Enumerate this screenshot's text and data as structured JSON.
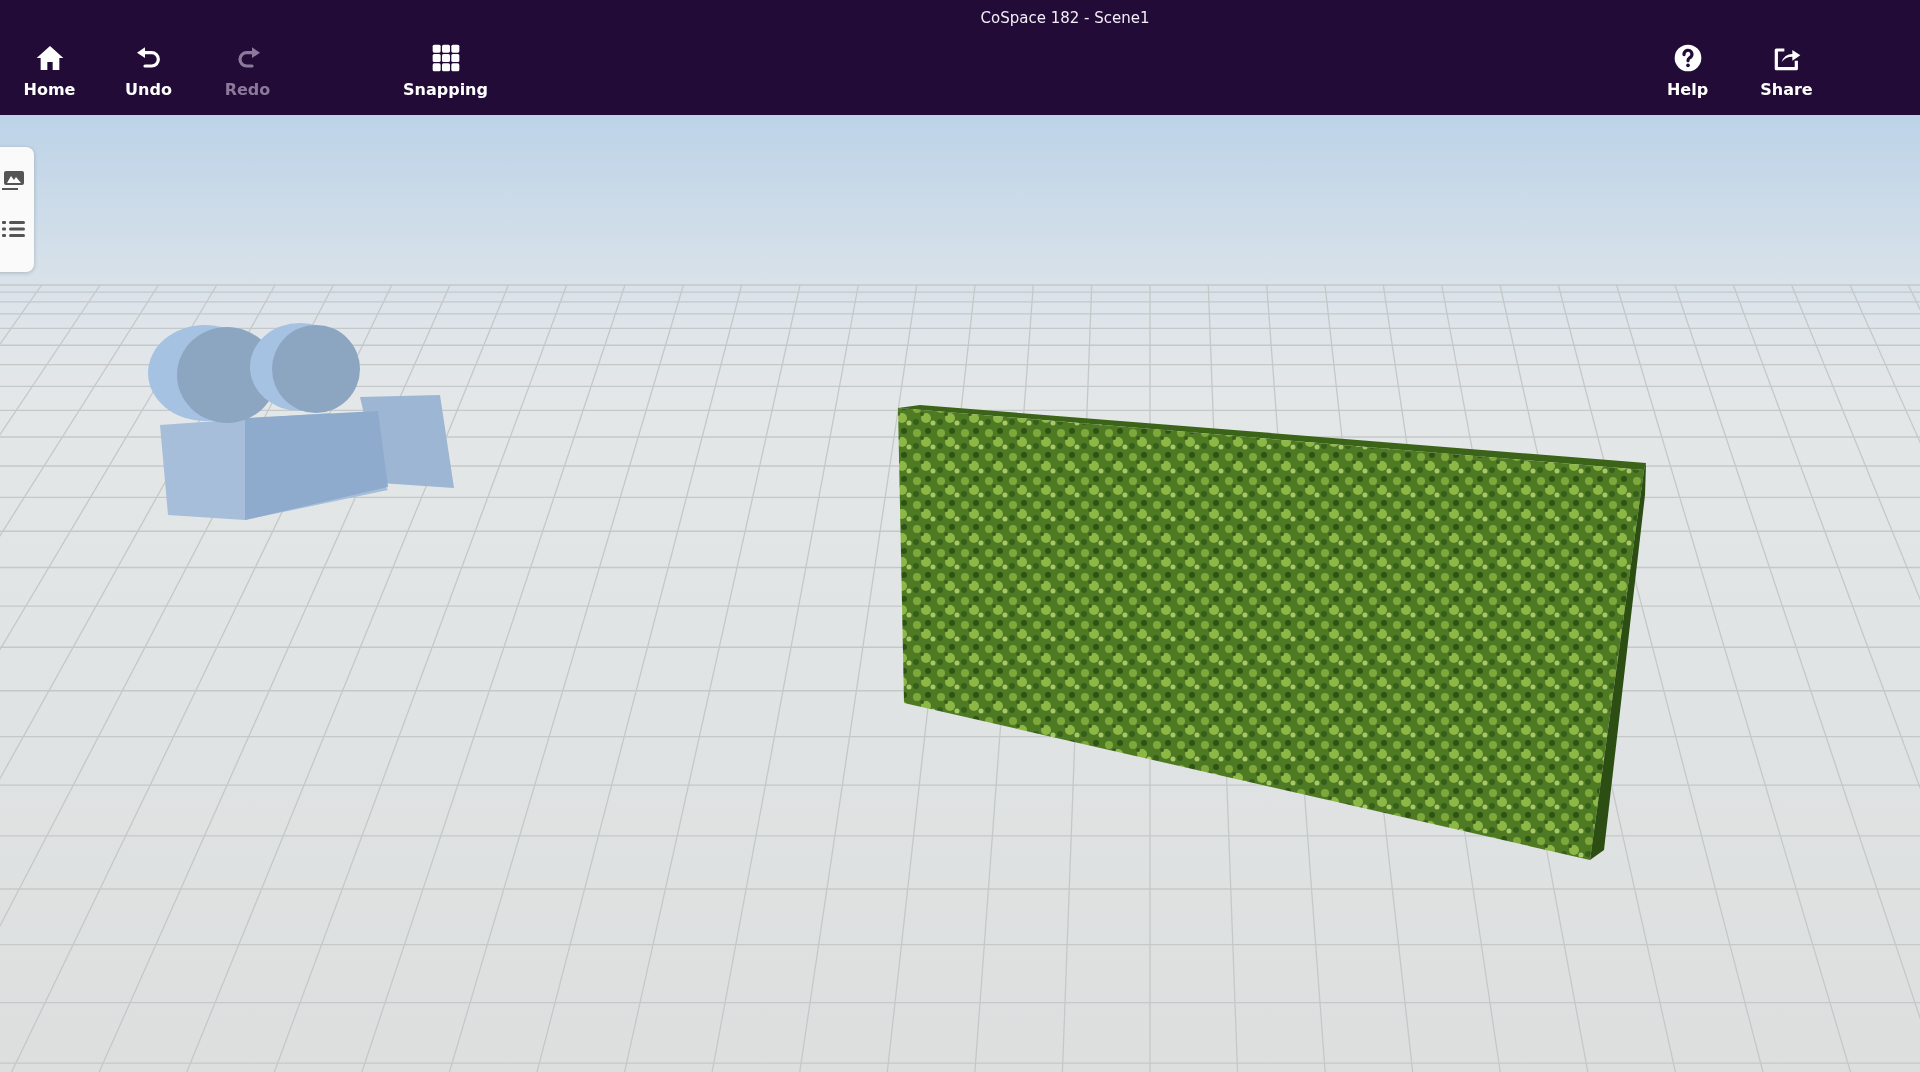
{
  "window": {
    "title": "CoSpace 182 - Scene1"
  },
  "toolbar": {
    "left": [
      {
        "kind": "home",
        "label": "Home",
        "disabled": false
      },
      {
        "kind": "undo",
        "label": "Undo",
        "disabled": false
      },
      {
        "kind": "redo",
        "label": "Redo",
        "disabled": true
      }
    ],
    "center": [
      {
        "kind": "snapping",
        "label": "Snapping",
        "disabled": false
      }
    ],
    "right": [
      {
        "kind": "help",
        "label": "Help",
        "disabled": false
      },
      {
        "kind": "share",
        "label": "Share",
        "disabled": false
      }
    ]
  },
  "side_panel": {
    "items": [
      {
        "kind": "image"
      },
      {
        "kind": "list"
      }
    ]
  }
}
